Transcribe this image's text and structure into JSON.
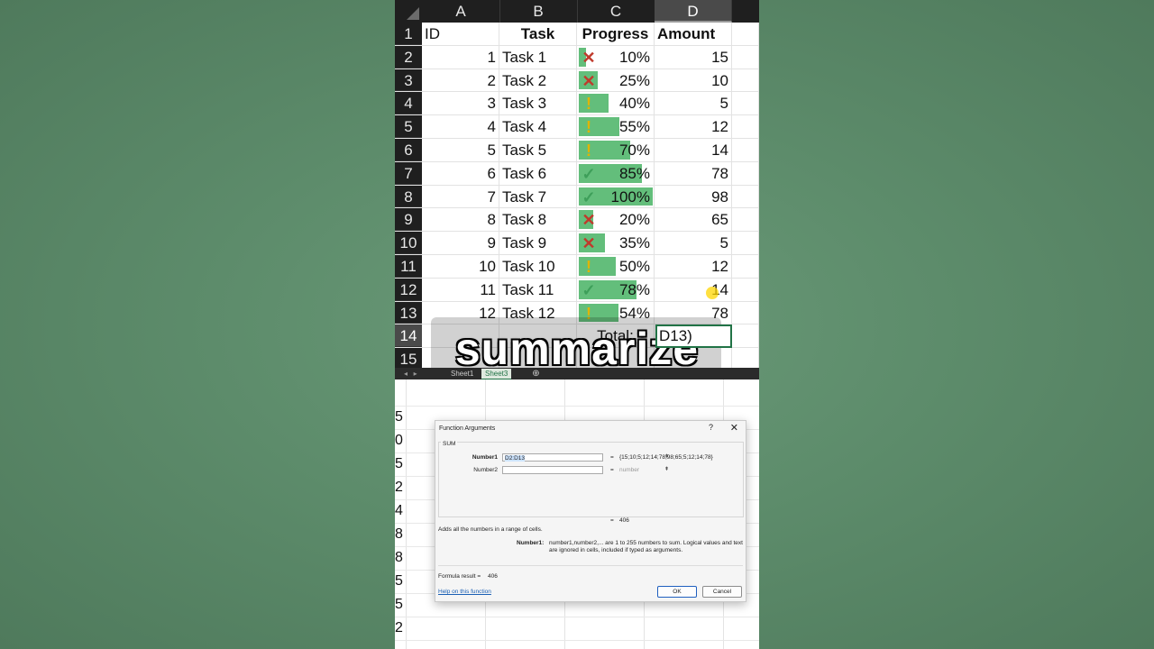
{
  "sheet": {
    "columns": [
      "A",
      "B",
      "C",
      "D"
    ],
    "selected_column": "D",
    "row_numbers": [
      "1",
      "2",
      "3",
      "4",
      "5",
      "6",
      "7",
      "8",
      "9",
      "10",
      "11",
      "12",
      "13",
      "14",
      "15"
    ],
    "header": {
      "id": "ID",
      "task": "Task",
      "progress": "Progress",
      "amount": "Amount"
    },
    "rows": [
      {
        "id": "1",
        "task": "Task 1",
        "icon": "✕",
        "icon_type": "x",
        "progress": "10%",
        "progress_value": 0.1,
        "amount": "15"
      },
      {
        "id": "2",
        "task": "Task 2",
        "icon": "✕",
        "icon_type": "x",
        "progress": "25%",
        "progress_value": 0.25,
        "amount": "10"
      },
      {
        "id": "3",
        "task": "Task 3",
        "icon": "!",
        "icon_type": "warn",
        "progress": "40%",
        "progress_value": 0.4,
        "amount": "5"
      },
      {
        "id": "4",
        "task": "Task 4",
        "icon": "!",
        "icon_type": "warn",
        "progress": "55%",
        "progress_value": 0.55,
        "amount": "12"
      },
      {
        "id": "5",
        "task": "Task 5",
        "icon": "!",
        "icon_type": "warn",
        "progress": "70%",
        "progress_value": 0.7,
        "amount": "14"
      },
      {
        "id": "6",
        "task": "Task 6",
        "icon": "✓",
        "icon_type": "ok",
        "progress": "85%",
        "progress_value": 0.85,
        "amount": "78"
      },
      {
        "id": "7",
        "task": "Task 7",
        "icon": "✓",
        "icon_type": "ok",
        "progress": "100%",
        "progress_value": 1.0,
        "amount": "98"
      },
      {
        "id": "8",
        "task": "Task 8",
        "icon": "✕",
        "icon_type": "x",
        "progress": "20%",
        "progress_value": 0.2,
        "amount": "65"
      },
      {
        "id": "9",
        "task": "Task 9",
        "icon": "✕",
        "icon_type": "x",
        "progress": "35%",
        "progress_value": 0.35,
        "amount": "5"
      },
      {
        "id": "10",
        "task": "Task 10",
        "icon": "!",
        "icon_type": "warn",
        "progress": "50%",
        "progress_value": 0.5,
        "amount": "12"
      },
      {
        "id": "11",
        "task": "Task 11",
        "icon": "✓",
        "icon_type": "ok",
        "progress": "78%",
        "progress_value": 0.78,
        "amount": "14"
      },
      {
        "id": "12",
        "task": "Task 12",
        "icon": "!",
        "icon_type": "warn",
        "progress": "54%",
        "progress_value": 0.54,
        "amount": "78"
      }
    ],
    "total_label": "Total:",
    "total_formula_fragment": "D13)",
    "bar_color": "#63be7b",
    "caption": "summarize",
    "tabs": [
      "Sheet1",
      "Sheet3"
    ],
    "active_tab": "Sheet3",
    "add_sheet_icon": "plus-circle-icon"
  },
  "background_sheet": {
    "left_column_values": [
      "5",
      "0",
      "5",
      "2",
      "4",
      "8",
      "8",
      "5",
      "5",
      "2"
    ]
  },
  "dialog": {
    "title": "Function Arguments",
    "help_symbol": "?",
    "close_symbol": "✕",
    "function_name": "SUM",
    "args": [
      {
        "label": "Number1",
        "value": "D2:D13",
        "result": "{15;10;5;12;14;78;98;65;5;12;14;78}"
      },
      {
        "label": "Number2",
        "value": "",
        "result": "number"
      }
    ],
    "equals": "=",
    "total_result": "406",
    "description": "Adds all the numbers in a range of cells.",
    "arg_desc_label": "Number1:",
    "arg_desc": "number1,number2,... are 1 to 255 numbers to sum. Logical values and text are ignored in cells, included if typed as arguments.",
    "formula_result_label": "Formula result =",
    "formula_result_value": "406",
    "help_link": "Help on this function",
    "ok_label": "OK",
    "cancel_label": "Cancel"
  }
}
